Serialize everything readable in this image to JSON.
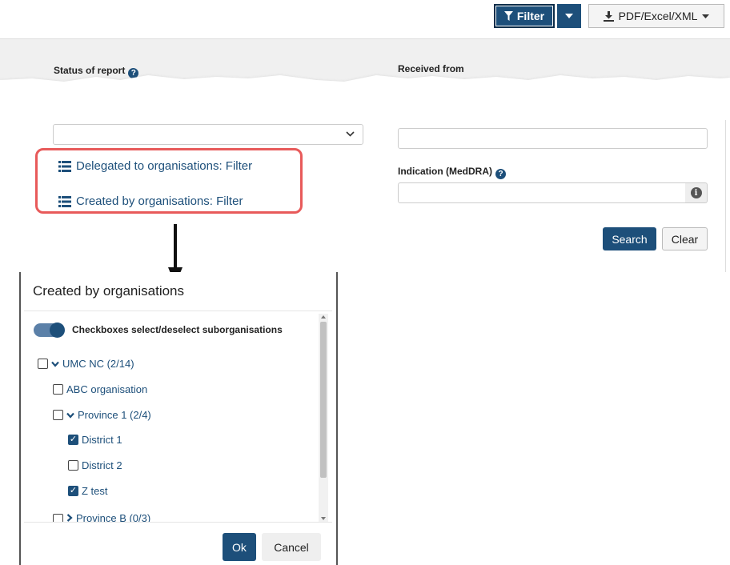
{
  "toolbar": {
    "filter_label": "Filter",
    "export_label": "PDF/Excel/XML",
    "filter_icon": "funnel-icon",
    "export_icon": "download-icon"
  },
  "form": {
    "status_label": "Status of report",
    "received_label": "Received from",
    "indication_label": "Indication (MedDRA)",
    "delegated_link": "Delegated to organisations: Filter",
    "created_link": "Created by organisations: Filter",
    "search_button": "Search",
    "clear_button": "Clear"
  },
  "modal": {
    "title": "Created by organisations",
    "toggle_label": "Checkboxes select/deselect suborganisations",
    "toggle_on": true,
    "tree": [
      {
        "label": "UMC NC (2/14)",
        "checked": false,
        "expanded": true
      },
      {
        "label": "ABC organisation",
        "checked": false
      },
      {
        "label": "Province 1 (2/4)",
        "checked": false,
        "expanded": true
      },
      {
        "label": "District 1",
        "checked": true
      },
      {
        "label": "District 2",
        "checked": false
      },
      {
        "label": "Z test",
        "checked": true
      },
      {
        "label": "Province B (0/3)",
        "checked": false,
        "expanded": false
      }
    ],
    "ok_button": "Ok",
    "cancel_button": "Cancel"
  },
  "colors": {
    "primary": "#1d4f7a",
    "highlight": "#e85a5a"
  }
}
